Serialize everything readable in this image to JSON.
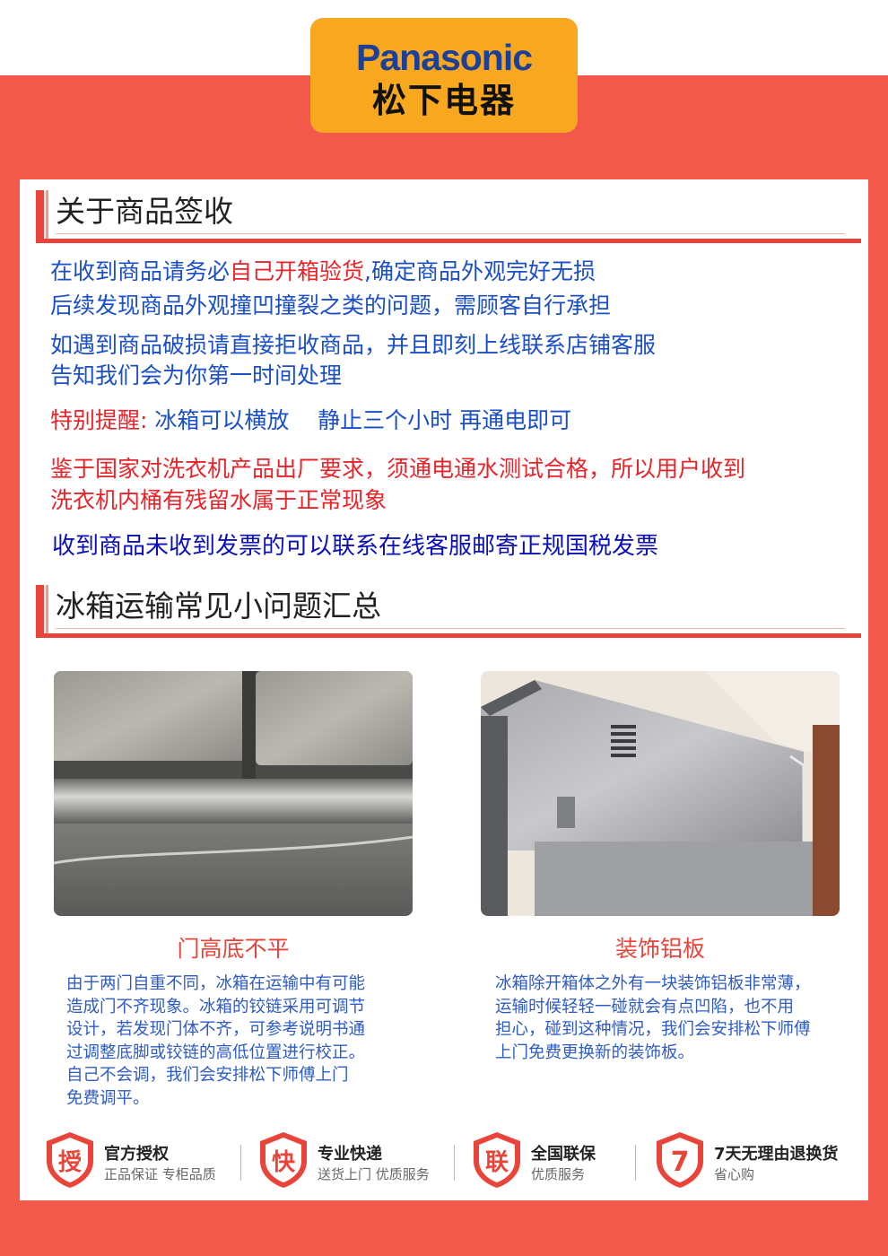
{
  "brand": {
    "name_en": "Panasonic",
    "name_cn": "松下电器"
  },
  "section1": {
    "title": "关于商品签收",
    "line1_part1": "在收到商品请务必",
    "line1_highlight": "自己开箱验货",
    "line1_part2": ",确定商品外观完好无损",
    "line2": "后续发现商品外观撞凹撞裂之类的问题，需顾客自行承担",
    "line3": "如遇到商品破损请直接拒收商品，并且即刻上线联系店铺客服",
    "line4": "告知我们会为你第一时间处理",
    "notice_label": "特别提醒:",
    "notice_text": "冰箱可以横放    静止三个小时 再通电即可",
    "washer_line1": "鉴于国家对洗衣机产品出厂要求，须通电通水测试合格，所以用户收到",
    "washer_line2": "洗衣机内桶有残留水属于正常现象",
    "invoice": "收到商品未收到发票的可以联系在线客服邮寄正规国税发票"
  },
  "section2": {
    "title": "冰箱运输常见小问题汇总",
    "left": {
      "caption": "门高底不平",
      "desc": [
        "由于两门自重不同，冰箱在运输中有可能",
        "造成门不齐现象。冰箱的铰链采用可调节",
        "设计，若发现门体不齐，可参考说明书通",
        "过调整底脚或铰链的高低位置进行校正。",
        "自己不会调，我们会安排松下师傅上门",
        "免费调平。"
      ]
    },
    "right": {
      "caption": "装饰铝板",
      "desc": [
        "冰箱除开箱体之外有一块装饰铝板非常薄，",
        "运输时候轻轻一碰就会有点凹陷，也不用",
        "担心，碰到这种情况，我们会安排松下师傅",
        "上门免费更换新的装饰板。"
      ]
    }
  },
  "badges": [
    {
      "char": "授",
      "title": "官方授权",
      "sub": "正品保证 专柜品质"
    },
    {
      "char": "快",
      "title": "专业快递",
      "sub": "送货上门 优质服务"
    },
    {
      "char": "联",
      "title": "全国联保",
      "sub": "优质服务"
    },
    {
      "char": "7",
      "title": "7天无理由退换货",
      "sub": "省心购"
    }
  ],
  "colors": {
    "accent_red": "#e8443a",
    "background_red": "#f2594b",
    "brand_orange": "#f8a81f",
    "brand_blue": "#1c3f98",
    "text_blue": "#1b4fc8"
  }
}
